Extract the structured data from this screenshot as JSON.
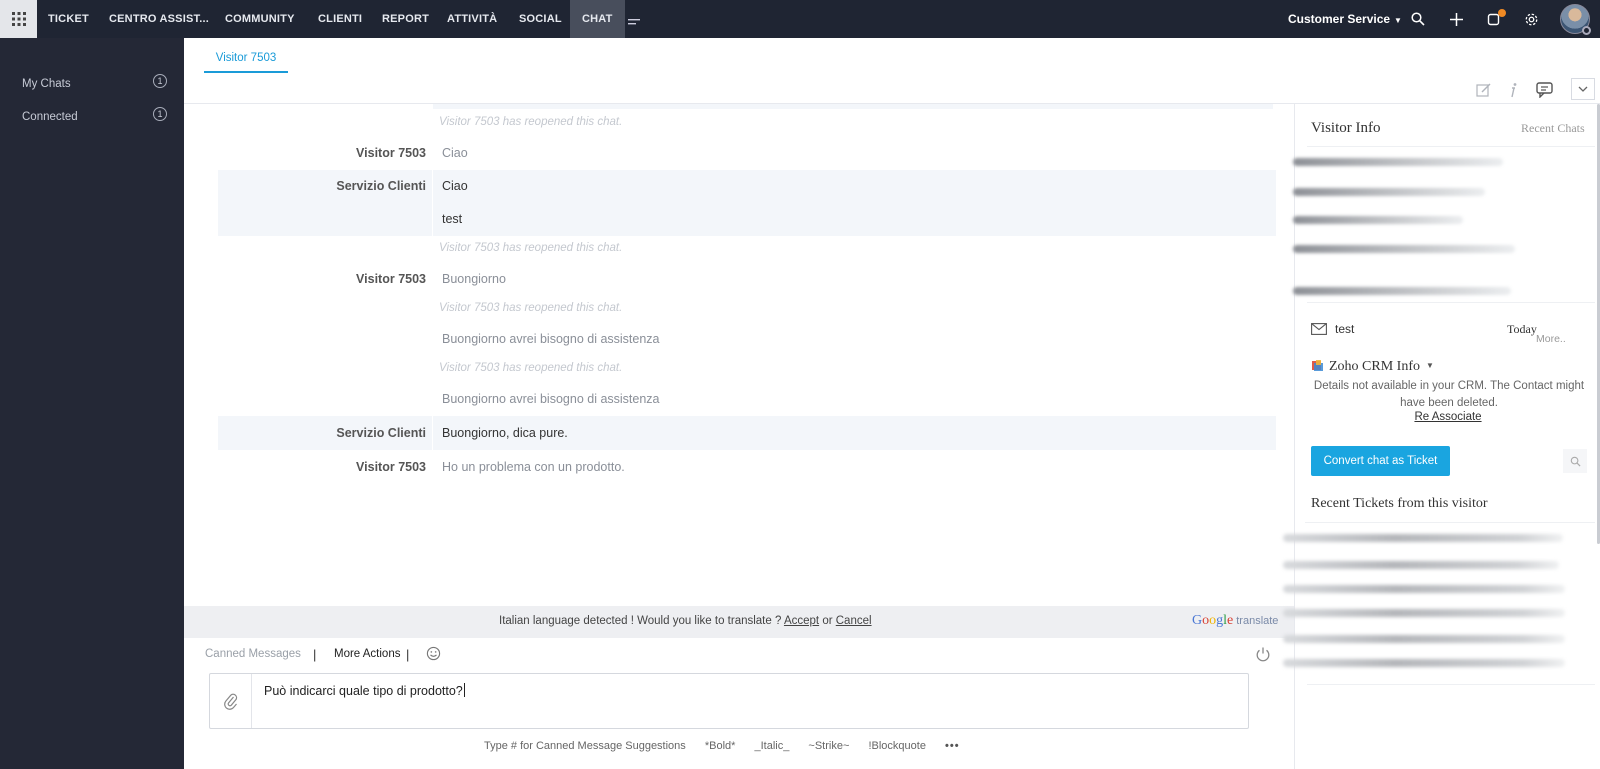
{
  "nav": {
    "items": [
      "TICKET",
      "CENTRO ASSIST...",
      "COMMUNITY",
      "CLIENTI",
      "REPORT",
      "ATTIVITÀ",
      "SOCIAL",
      "CHAT"
    ],
    "active": "CHAT",
    "department": "Customer Service",
    "icons": [
      "apps-grid-icon",
      "more-menu-icon",
      "search-icon",
      "plus-icon",
      "notifications-icon",
      "settings-icon"
    ]
  },
  "sidebar": {
    "items": [
      {
        "label": "My Chats",
        "count": "1"
      },
      {
        "label": "Connected",
        "count": "1"
      }
    ]
  },
  "chat": {
    "tab": "Visitor 7503",
    "transcript": {
      "sys1": "Visitor 7503 has reopened this chat.",
      "s1": "Visitor 7503",
      "m1": "Ciao",
      "s2": "Servizio Clienti",
      "m2a": "Ciao",
      "m2b": "test",
      "sys2": "Visitor 7503 has reopened this chat.",
      "s3": "Visitor 7503",
      "m3": "Buongiorno",
      "sys3": "Visitor 7503 has reopened this chat.",
      "m4": "Buongiorno avrei bisogno di assistenza",
      "sys4": "Visitor 7503 has reopened this chat.",
      "m5": "Buongiorno avrei bisogno di assistenza",
      "s6": "Servizio Clienti",
      "m6": "Buongiorno, dica pure.",
      "s7": "Visitor 7503",
      "m7": "Ho un problema con un prodotto."
    }
  },
  "translate": {
    "text": "Italian language detected ! Would you like to translate ?",
    "accept": "Accept",
    "or": "or",
    "cancel": "Cancel",
    "brand": "Google",
    "brand_suffix": "translate"
  },
  "composer": {
    "canned": "Canned Messages",
    "sep": "|",
    "more_actions": "More Actions",
    "value": "Può indicarci quale tipo di prodotto?",
    "hints": {
      "h1": "Type # for Canned Message Suggestions",
      "h2": "*Bold*",
      "h3": "_Italic_",
      "h4": "~Strike~",
      "h5": "!Blockquote",
      "h6": "•••"
    }
  },
  "visitor_info": {
    "title": "Visitor Info",
    "recent_chats": "Recent Chats",
    "mail_label": "test",
    "mail_date": "Today",
    "more": "More..",
    "crm_title": "Zoho CRM Info",
    "crm_message": "Details not available in your CRM. The Contact might have been deleted.",
    "re_associate": "Re Associate",
    "convert_button": "Convert chat as Ticket",
    "recent_tickets_title": "Recent Tickets from this visitor"
  },
  "colors": {
    "topbar": "#1f2533",
    "sidebar": "#242836",
    "accent": "#1a9bd8",
    "button": "#1aa5e0"
  }
}
